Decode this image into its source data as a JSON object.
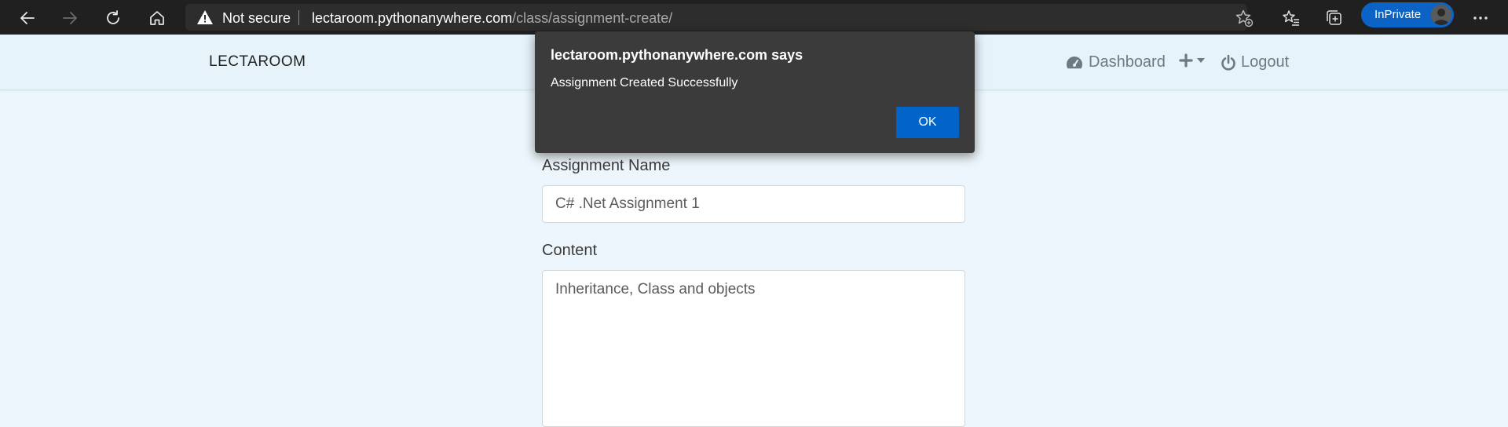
{
  "browser": {
    "security_label": "Not secure",
    "url_host": "lectaroom.pythonanywhere.com",
    "url_path": "/class/assignment-create/",
    "profile_label": "InPrivate",
    "icons": [
      "back-icon",
      "forward-icon",
      "refresh-icon",
      "home-icon",
      "warning-icon",
      "favorite-add-icon",
      "favorites-icon",
      "collections-icon",
      "profile-avatar-icon",
      "more-icon"
    ]
  },
  "navbar": {
    "brand": "LECTAROOM",
    "dashboard_label": "Dashboard",
    "logout_label": "Logout"
  },
  "form": {
    "name_label": "Assignment Name",
    "name_value": "C# .Net Assignment 1",
    "content_label": "Content",
    "content_value": "Inheritance, Class and objects"
  },
  "dialog": {
    "title": "lectaroom.pythonanywhere.com says",
    "message": "Assignment Created Successfully",
    "ok_label": "OK"
  },
  "colors": {
    "page_bg": "#ecf6fc",
    "dialog_bg": "#3b3b3b",
    "accent": "#0064c8"
  }
}
